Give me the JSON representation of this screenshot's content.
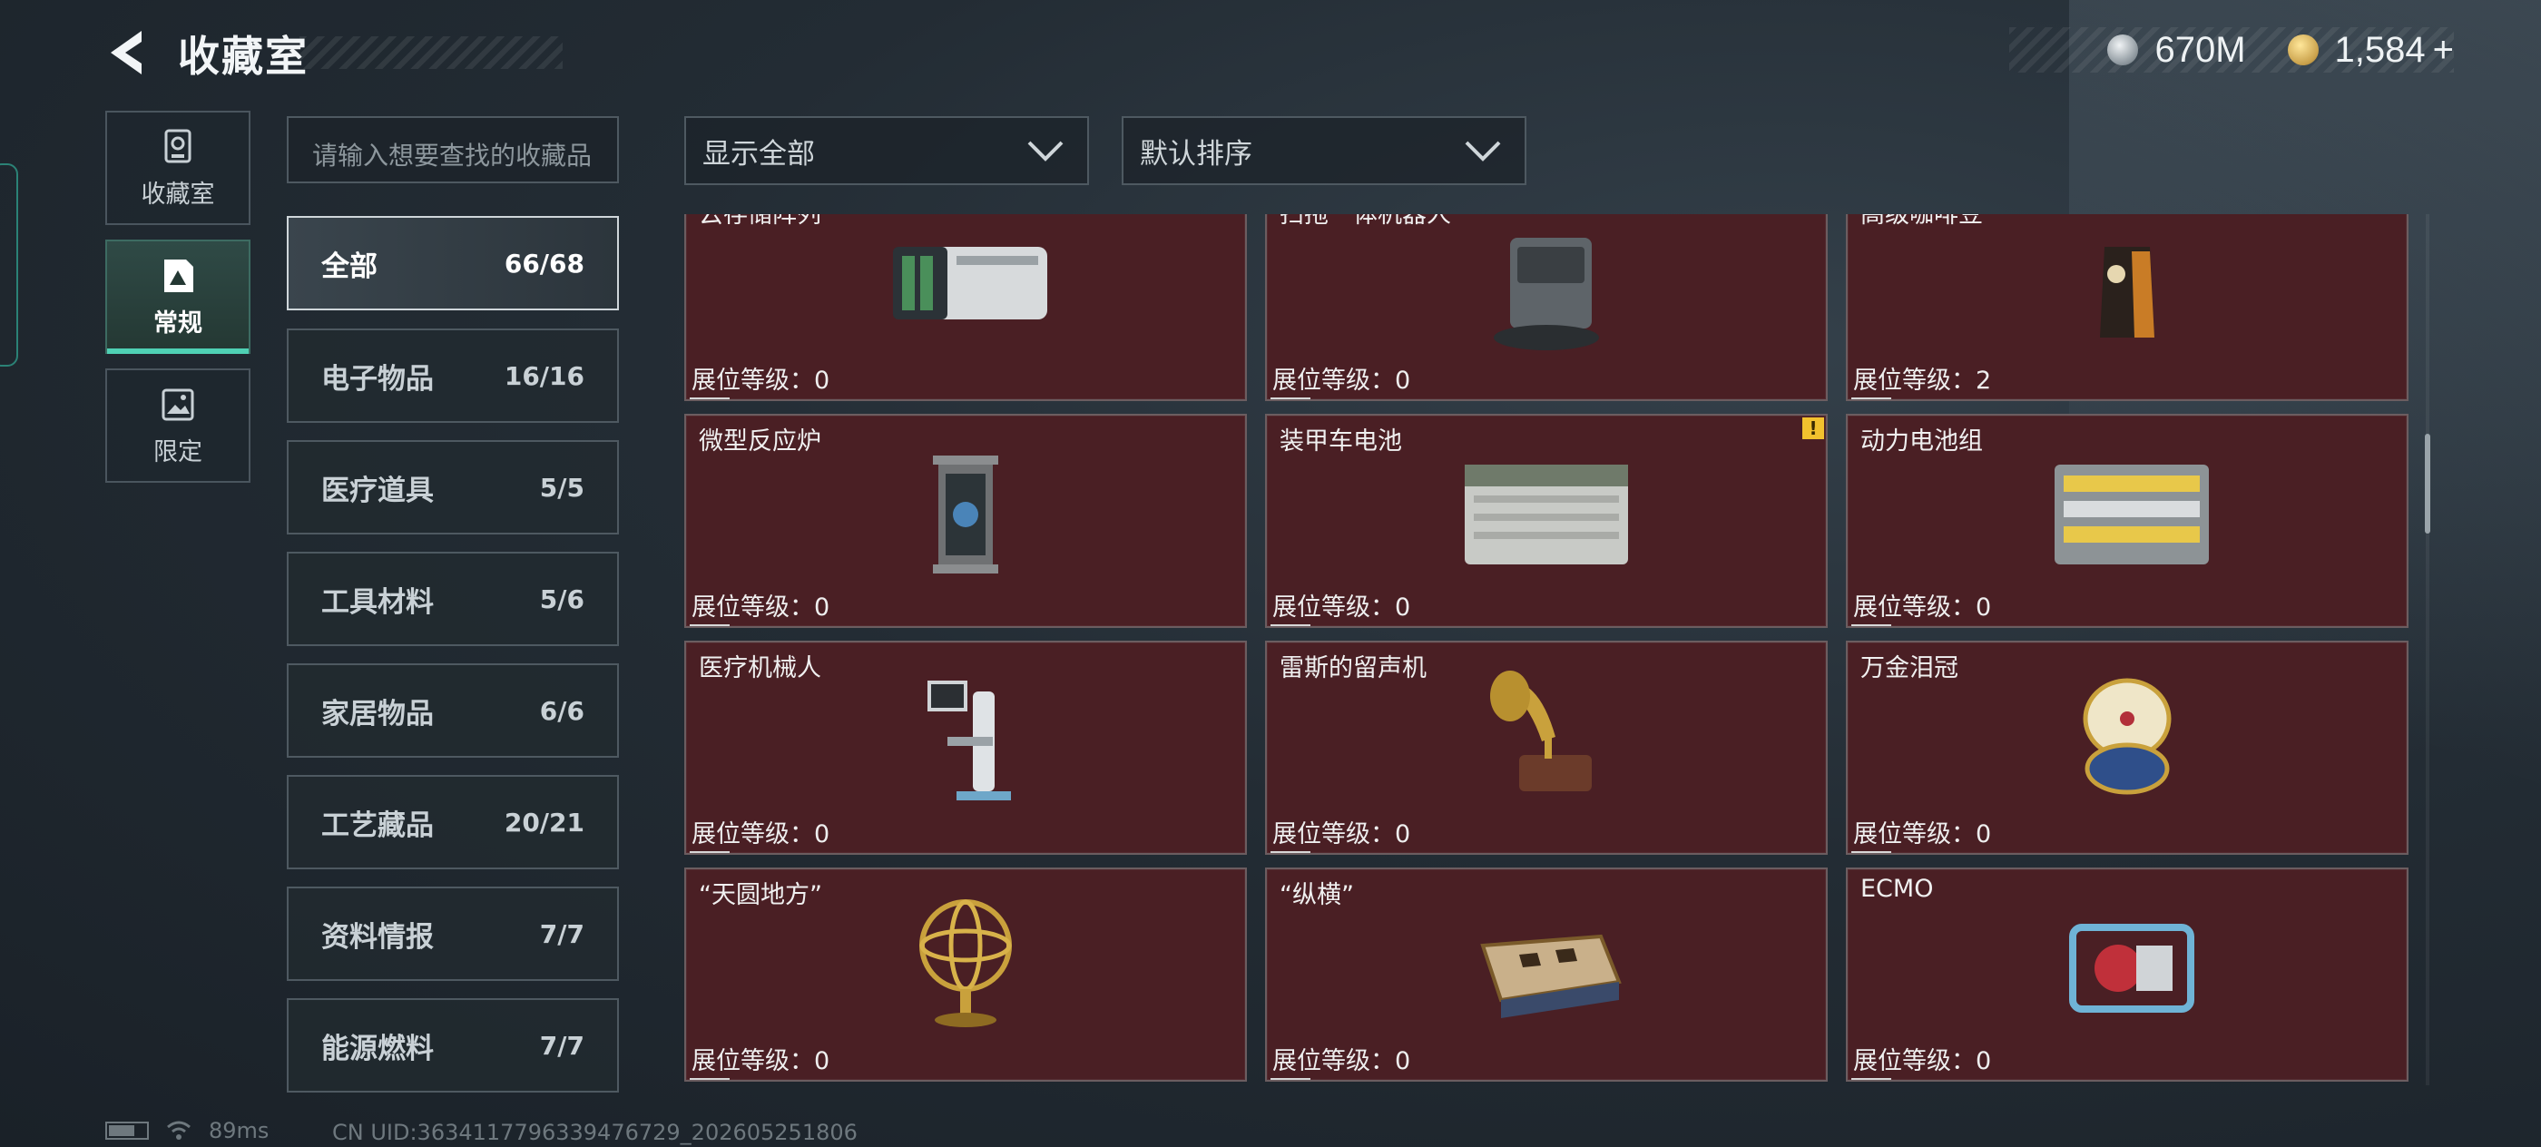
{
  "header": {
    "title": "收藏室",
    "currency_silver": "670M",
    "currency_gold": "1,584",
    "add_symbol": "+"
  },
  "nav": [
    {
      "label": "收藏室",
      "icon": "trophy-icon",
      "active": false
    },
    {
      "label": "常规",
      "icon": "document-icon",
      "active": true
    },
    {
      "label": "限定",
      "icon": "image-icon",
      "active": false
    }
  ],
  "search": {
    "placeholder": "请输入想要查找的收藏品"
  },
  "categories": [
    {
      "name": "全部",
      "count": "66/68",
      "active": true
    },
    {
      "name": "电子物品",
      "count": "16/16"
    },
    {
      "name": "医疗道具",
      "count": "5/5"
    },
    {
      "name": "工具材料",
      "count": "5/6"
    },
    {
      "name": "家居物品",
      "count": "6/6"
    },
    {
      "name": "工艺藏品",
      "count": "20/21"
    },
    {
      "name": "资料情报",
      "count": "7/7"
    },
    {
      "name": "能源燃料",
      "count": "7/7"
    }
  ],
  "filters": {
    "display": "显示全部",
    "sort": "默认排序"
  },
  "items": [
    {
      "name": "云存储阵列",
      "rank": "展位等级：0",
      "art": "server-array-icon"
    },
    {
      "name": "扫拖一体机器人",
      "rank": "展位等级：0",
      "art": "robot-vacuum-icon"
    },
    {
      "name": "高级咖啡豆",
      "rank": "展位等级：2",
      "art": "coffee-bag-icon"
    },
    {
      "name": "微型反应炉",
      "rank": "展位等级：0",
      "art": "reactor-icon"
    },
    {
      "name": "装甲车电池",
      "rank": "展位等级：0",
      "art": "car-battery-icon",
      "alert": "!"
    },
    {
      "name": "动力电池组",
      "rank": "展位等级：0",
      "art": "battery-pack-icon"
    },
    {
      "name": "医疗机械人",
      "rank": "展位等级：0",
      "art": "medical-robot-icon"
    },
    {
      "name": "雷斯的留声机",
      "rank": "展位等级：0",
      "art": "gramophone-icon"
    },
    {
      "name": "万金泪冠",
      "rank": "展位等级：0",
      "art": "jeweled-egg-icon"
    },
    {
      "name": "“天圆地方”",
      "rank": "展位等级：0",
      "art": "armillary-sphere-icon"
    },
    {
      "name": "“纵横”",
      "rank": "展位等级：0",
      "art": "chess-box-icon"
    },
    {
      "name": "ECMO",
      "rank": "展位等级：0",
      "art": "ecmo-machine-icon"
    }
  ],
  "status": {
    "ping": "89ms",
    "uid": "CN UID:3634117796339476729_202605251806"
  },
  "colors": {
    "card_bg": "#4a1f24",
    "accent": "#4fd1b4",
    "alert": "#f2c12e"
  }
}
